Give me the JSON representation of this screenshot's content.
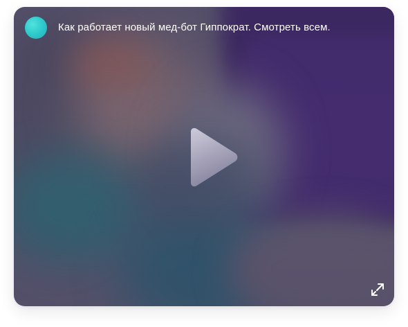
{
  "video": {
    "title": "Как работает новый мед-бот Гиппократ. Смотреть всем."
  },
  "icons": {
    "avatar": "channel-avatar",
    "play": "play-icon",
    "open_external": "open-external-icon"
  },
  "colors": {
    "avatar": "#2cc7c9",
    "title_text": "#ffffff",
    "play_fill_top": "#c9c7d6",
    "play_fill_bottom": "#8f8ba6"
  }
}
